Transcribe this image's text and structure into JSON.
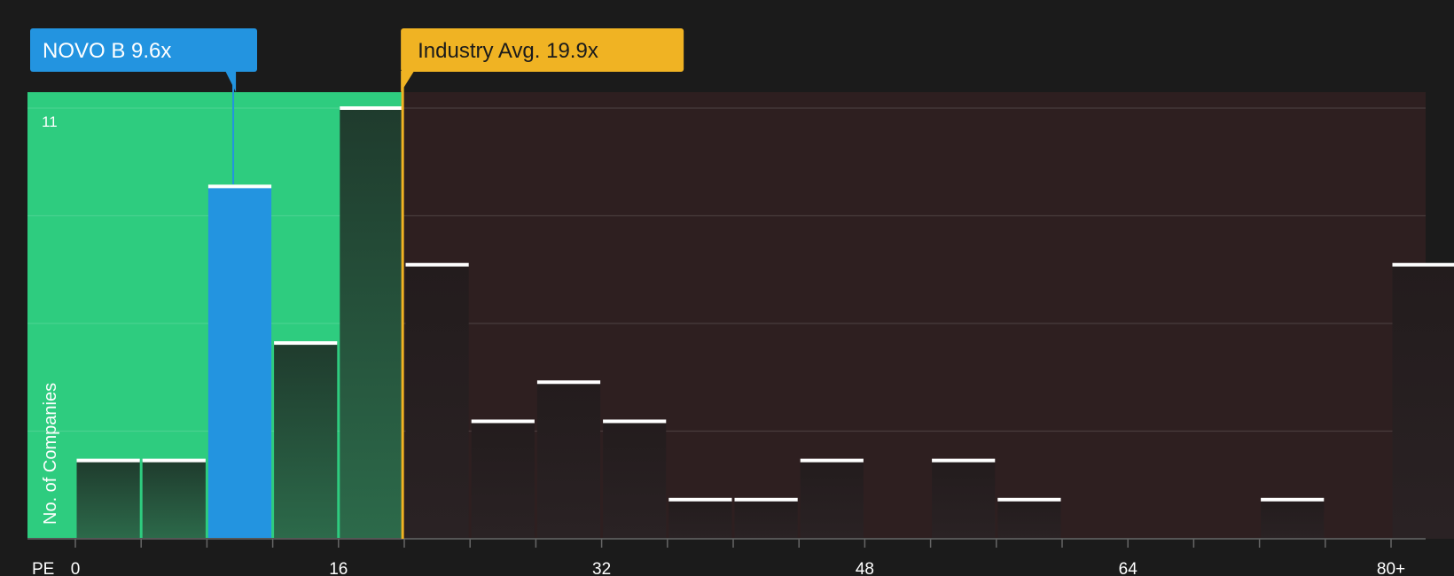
{
  "chart_data": {
    "type": "bar",
    "title": "",
    "xlabel": "PE",
    "ylabel": "No. of Companies",
    "ymax_label": "11",
    "x_tick_labels": [
      "0",
      "16",
      "32",
      "48",
      "64",
      "80+"
    ],
    "x_ticks": [
      0,
      16,
      32,
      48,
      64,
      80
    ],
    "xlim": [
      0,
      82
    ],
    "ylim": [
      0,
      11
    ],
    "bin_width": 4,
    "bins": [
      {
        "x0": 0,
        "value": 2,
        "highlight": false
      },
      {
        "x0": 4,
        "value": 2,
        "highlight": false
      },
      {
        "x0": 8,
        "value": 9,
        "highlight": true
      },
      {
        "x0": 12,
        "value": 5,
        "highlight": false
      },
      {
        "x0": 16,
        "value": 11,
        "highlight": false
      },
      {
        "x0": 20,
        "value": 7,
        "highlight": false
      },
      {
        "x0": 24,
        "value": 3,
        "highlight": false
      },
      {
        "x0": 28,
        "value": 4,
        "highlight": false
      },
      {
        "x0": 32,
        "value": 3,
        "highlight": false
      },
      {
        "x0": 36,
        "value": 1,
        "highlight": false
      },
      {
        "x0": 40,
        "value": 1,
        "highlight": false
      },
      {
        "x0": 44,
        "value": 2,
        "highlight": false
      },
      {
        "x0": 48,
        "value": 0,
        "highlight": false
      },
      {
        "x0": 52,
        "value": 2,
        "highlight": false
      },
      {
        "x0": 56,
        "value": 1,
        "highlight": false
      },
      {
        "x0": 60,
        "value": 0,
        "highlight": false
      },
      {
        "x0": 64,
        "value": 0,
        "highlight": false
      },
      {
        "x0": 68,
        "value": 0,
        "highlight": false
      },
      {
        "x0": 72,
        "value": 1,
        "highlight": false
      },
      {
        "x0": 76,
        "value": 0,
        "highlight": false
      },
      {
        "x0": 80,
        "value": 7,
        "highlight": false
      }
    ],
    "company": {
      "label": "NOVO B 9.6x",
      "value": 9.6
    },
    "industry": {
      "label": "Industry Avg. 19.9x",
      "value": 19.9
    },
    "fair_region_end": 19.9,
    "grid": true,
    "colors": {
      "background": "#1b1b1b",
      "undervalued_region": "#2ecc7f",
      "overvalued_region": "#2e1f20",
      "company": "#2394e0",
      "industry": "#f0b323",
      "bar_green_top": "#1f3a2c",
      "bar_green_bottom": "#2a6848",
      "bar_dark": "#231d1e",
      "bar_cap": "#ffffff",
      "text": "#ffffff",
      "axis": "#555555"
    }
  }
}
